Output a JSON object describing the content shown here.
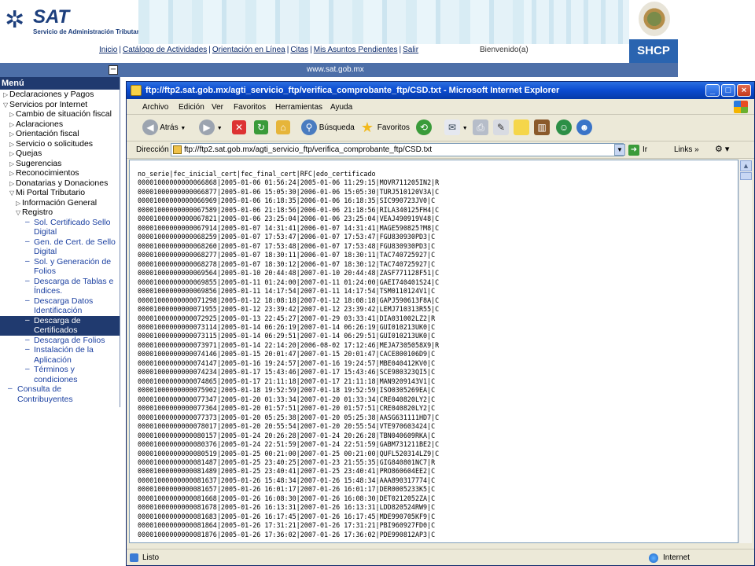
{
  "header": {
    "logo_text": "SAT",
    "logo_subtitle": "Servicio de Administración Tributaria",
    "nav_links": [
      "Inicio",
      "Catálogo de Actividades",
      "Orientación en Línea",
      "Citas",
      "Mis Asuntos Pendientes",
      "Salir"
    ],
    "welcome": "Bienvenido(a)",
    "shcp": "SHCP",
    "site_url": "www.sat.gob.mx"
  },
  "sidebar": {
    "title": "Menú",
    "items": [
      {
        "label": "Declaraciones y Pagos",
        "level": 0,
        "arrow": "right"
      },
      {
        "label": "Servicios por Internet",
        "level": 0,
        "arrow": "down"
      },
      {
        "label": "Cambio de situación fiscal",
        "level": 1,
        "arrow": "right"
      },
      {
        "label": "Aclaraciones",
        "level": 1,
        "arrow": "right"
      },
      {
        "label": "Orientación fiscal",
        "level": 1,
        "arrow": "right"
      },
      {
        "label": "Servicio o solicitudes",
        "level": 1,
        "arrow": "right"
      },
      {
        "label": "Quejas",
        "level": 1,
        "arrow": "right"
      },
      {
        "label": "Sugerencias",
        "level": 1,
        "arrow": "right"
      },
      {
        "label": "Reconocimientos",
        "level": 1,
        "arrow": "right"
      },
      {
        "label": "Donatarias y Donaciones",
        "level": 1,
        "arrow": "right"
      },
      {
        "label": "Mi Portal Tributario",
        "level": 1,
        "arrow": "down"
      },
      {
        "label": "Información General",
        "level": 2,
        "arrow": "right"
      },
      {
        "label": "Registro",
        "level": 2,
        "arrow": "down"
      },
      {
        "label": "Sol. Certificado Sello",
        "level": 3,
        "link": true
      },
      {
        "label": "Digital",
        "level": 3,
        "link": true,
        "cont": true
      },
      {
        "label": "Gen. de Cert. de Sello",
        "level": 3,
        "link": true
      },
      {
        "label": "Digital",
        "level": 3,
        "link": true,
        "cont": true
      },
      {
        "label": "Sol. y Generación de",
        "level": 3,
        "link": true
      },
      {
        "label": "Folios",
        "level": 3,
        "link": true,
        "cont": true
      },
      {
        "label": "Descarga de Tablas e",
        "level": 3,
        "link": true
      },
      {
        "label": "Índices.",
        "level": 3,
        "link": true,
        "cont": true
      },
      {
        "label": "Descarga Datos",
        "level": 3,
        "link": true
      },
      {
        "label": "Identificación",
        "level": 3,
        "link": true,
        "cont": true
      },
      {
        "label": "Descarga de",
        "level": 3,
        "link": true,
        "selected": true
      },
      {
        "label": "Certificados",
        "level": 3,
        "link": true,
        "cont": true,
        "selected": true
      },
      {
        "label": "Descarga de Folios",
        "level": 3,
        "link": true
      },
      {
        "label": "Instalación de la",
        "level": 3,
        "link": true
      },
      {
        "label": "Aplicación",
        "level": 3,
        "link": true,
        "cont": true
      },
      {
        "label": "Términos y",
        "level": 3,
        "link": true
      },
      {
        "label": "condiciones",
        "level": 3,
        "link": true,
        "cont": true
      },
      {
        "label": "Consulta de",
        "level": 1,
        "link": true,
        "dash": true
      },
      {
        "label": "Contribuyentes",
        "level": 1,
        "link": true,
        "cont": true
      }
    ]
  },
  "ie": {
    "title": "ftp://ftp2.sat.gob.mx/agti_servicio_ftp/verifica_comprobante_ftp/CSD.txt - Microsoft Internet Explorer",
    "menu": [
      "Archivo",
      "Edición",
      "Ver",
      "Favoritos",
      "Herramientas",
      "Ayuda"
    ],
    "toolbar": {
      "back": "Atrás",
      "search": "Búsqueda",
      "favorites": "Favoritos"
    },
    "address_label": "Dirección",
    "address": "ftp://ftp2.sat.gob.mx/agti_servicio_ftp/verifica_comprobante_ftp/CSD.txt",
    "go": "Ir",
    "links": "Links",
    "status": "Listo",
    "zone": "Internet"
  },
  "file_lines": [
    "no_serie|fec_inicial_cert|fec_final_cert|RFC|edo_certificado",
    "00001000000000066868|2005-01-06 01:56:24|2005-01-06 11:29:15|MOVR711205IN2|R",
    "00001000000000066877|2005-01-06 15:05:30|2006-01-06 15:05:30|TURJ510120V3A|C",
    "00001000000000066969|2005-01-06 16:18:35|2006-01-06 16:18:35|SIC990723JV0|C",
    "00001000000000067589|2005-01-06 21:18:56|2006-01-06 21:18:56|RILA340125FH4|C",
    "00001000000000067821|2005-01-06 23:25:04|2006-01-06 23:25:04|VEAJ490919V48|C",
    "00001000000000067914|2005-01-07 14:31:41|2006-01-07 14:31:41|MAGE590825?M8|C",
    "00001000000000068259|2005-01-07 17:53:47|2006-01-07 17:53:47|FGU830930PD3|C",
    "00001000000000068260|2005-01-07 17:53:48|2006-01-07 17:53:48|FGU830930PD3|C",
    "00001000000000068277|2005-01-07 18:30:11|2006-01-07 18:30:11|TAC740725927|C",
    "00001000000000068278|2005-01-07 18:30:12|2006-01-07 18:30:12|TAC740725927|C",
    "00001000000000069564|2005-01-10 20:44:48|2007-01-10 20:44:48|ZASF771128F51|C",
    "00001000000000069855|2005-01-11 01:24:00|2007-01-11 01:24:00|GAEI740401S24|C",
    "00001000000000069856|2005-01-11 14:17:54|2007-01-11 14:17:54|TSM0110124V1|C",
    "00001000000000071298|2005-01-12 18:08:18|2007-01-12 18:08:18|GAPJ590613F8A|C",
    "00001000000000071955|2005-01-12 23:39:42|2007-01-12 23:39:42|LEMJ710313R55|C",
    "00001000000000072925|2005-01-13 22:45:27|2007-01-29 03:33:41|DIA031002LZ2|R",
    "00001000000000073114|2005-01-14 06:26:19|2007-01-14 06:26:19|GUI010213UK0|C",
    "00001000000000073115|2005-01-14 06:29:51|2007-01-14 06:29:51|GUI010213UK0|C",
    "00001000000000073971|2005-01-14 22:14:20|2006-08-02 17:12:46|MEJA7305058X9|R",
    "00001000000000074146|2005-01-15 20:01:47|2007-01-15 20:01:47|CACE800106D9|C",
    "00001000000000074147|2005-01-16 19:24:57|2007-01-16 19:24:57|MBE040412KV0|C",
    "00001000000000074234|2005-01-17 15:43:46|2007-01-17 15:43:46|SCE980323QI5|C",
    "00001000000000074865|2005-01-17 21:11:18|2007-01-17 21:11:18|MAN9209143V1|C",
    "00001000000000075902|2005-01-18 19:52:59|2007-01-18 19:52:59|ISO0305269EA|C",
    "00001000000000077347|2005-01-20 01:33:34|2007-01-20 01:33:34|CRE040820LY2|C",
    "00001000000000077364|2005-01-20 01:57:51|2007-01-20 01:57:51|CRE040820LY2|C",
    "00001000000000077373|2005-01-20 05:25:38|2007-01-20 05:25:38|AASG631111HD7|C",
    "00001000000000078017|2005-01-20 20:55:54|2007-01-20 20:55:54|VTE970603424|C",
    "00001000000000080157|2005-01-24 20:26:28|2007-01-24 20:26:28|TBN040609RKA|C",
    "00001000000000080376|2005-01-24 22:51:59|2007-01-24 22:51:59|GABM731211BE2|C",
    "00001000000000080519|2005-01-25 00:21:00|2007-01-25 00:21:00|QUFL520314LZ9|C",
    "00001000000000081487|2005-01-25 23:40:25|2007-01-23 21:55:35|GIG840801NC7|R",
    "00001000000000081489|2005-01-25 23:40:41|2007-01-25 23:40:41|PRO860604EE2|C",
    "00001000000000081637|2005-01-26 15:48:34|2007-01-26 15:48:34|AAA890317774|C",
    "00001000000000081657|2005-01-26 16:01:17|2007-01-26 16:01:17|DER0005233K5|C",
    "00001000000000081668|2005-01-26 16:08:30|2007-01-26 16:08:30|DET0212052ZA|C",
    "00001000000000081678|2005-01-26 16:13:31|2007-01-26 16:13:31|LDD820524RW9|C",
    "00001000000000081683|2005-01-26 16:17:45|2007-01-26 16:17:45|MDE990705KF9|C",
    "00001000000000081864|2005-01-26 17:31:21|2007-01-26 17:31:21|PBI960927FD0|C",
    "00001000000000081876|2005-01-26 17:36:02|2007-01-26 17:36:02|PDE990812AP3|C"
  ]
}
